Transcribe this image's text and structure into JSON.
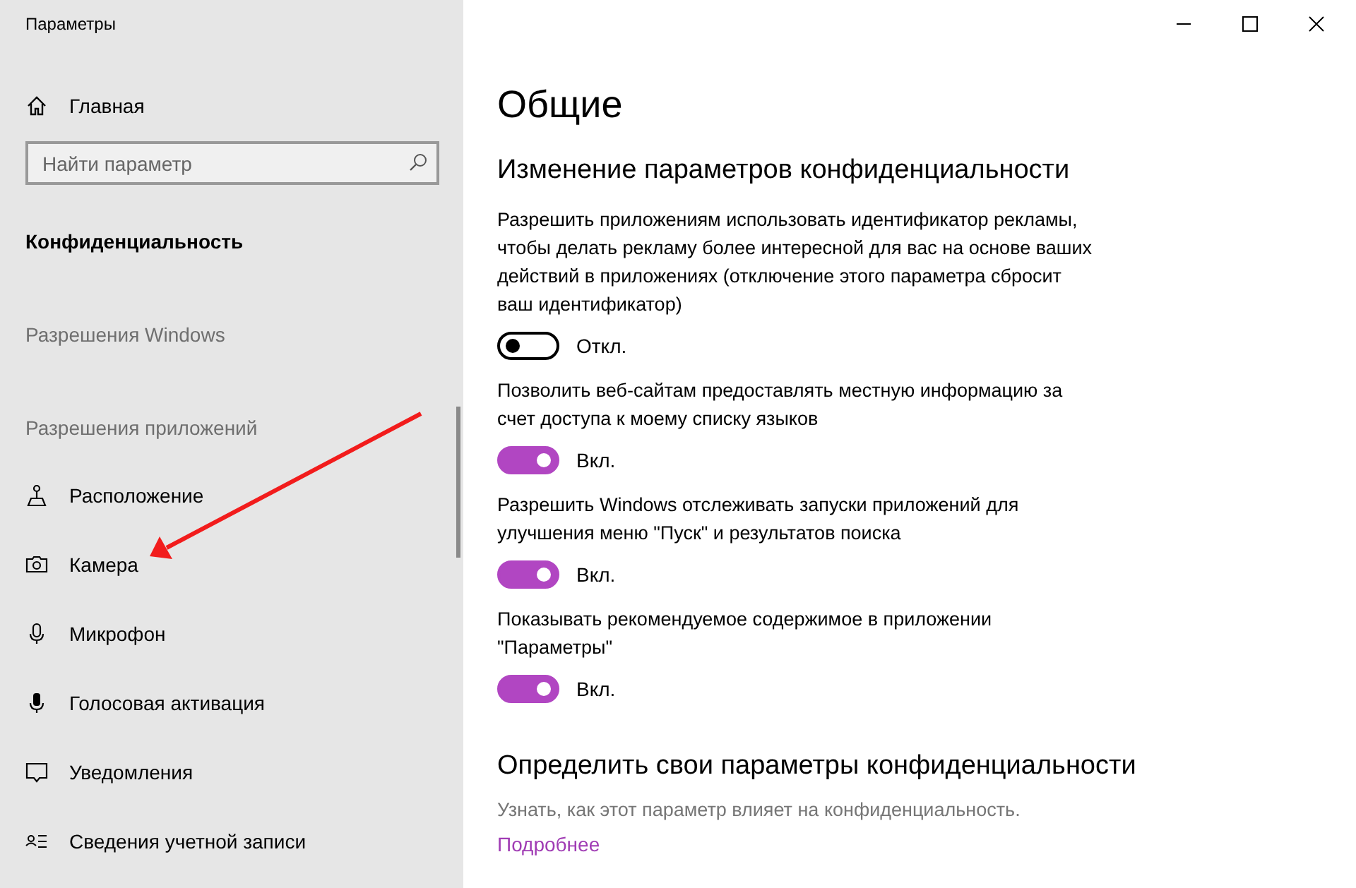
{
  "window": {
    "title": "Параметры"
  },
  "sidebar": {
    "home": "Главная",
    "search": {
      "placeholder": "Найти параметр"
    },
    "section": "Конфиденциальность",
    "groups": [
      "Разрешения Windows",
      "Разрешения приложений"
    ],
    "items": [
      {
        "label": "Расположение"
      },
      {
        "label": "Камера"
      },
      {
        "label": "Микрофон"
      },
      {
        "label": "Голосовая активация"
      },
      {
        "label": "Уведомления"
      },
      {
        "label": "Сведения учетной записи"
      }
    ]
  },
  "page": {
    "title": "Общие",
    "section_title": "Изменение параметров конфиденциальности",
    "settings": [
      {
        "description": "Разрешить приложениям использовать идентификатор рекламы, чтобы делать рекламу более интересной для вас на основе ваших действий в приложениях (отключение этого параметра сбросит ваш идентификатор)",
        "on": false,
        "state_label": "Откл."
      },
      {
        "description": "Позволить веб-сайтам предоставлять местную информацию за счет доступа к моему списку языков",
        "on": true,
        "state_label": "Вкл."
      },
      {
        "description": "Разрешить Windows отслеживать запуски приложений для улучшения меню \"Пуск\" и результатов поиска",
        "on": true,
        "state_label": "Вкл."
      },
      {
        "description": "Показывать рекомендуемое содержимое в приложении \"Параметры\"",
        "on": true,
        "state_label": "Вкл."
      }
    ],
    "privacy_title": "Определить свои параметры конфиденциальности",
    "privacy_text": "Узнать, как этот параметр влияет на конфиденциальность.",
    "link": "Подробнее"
  }
}
